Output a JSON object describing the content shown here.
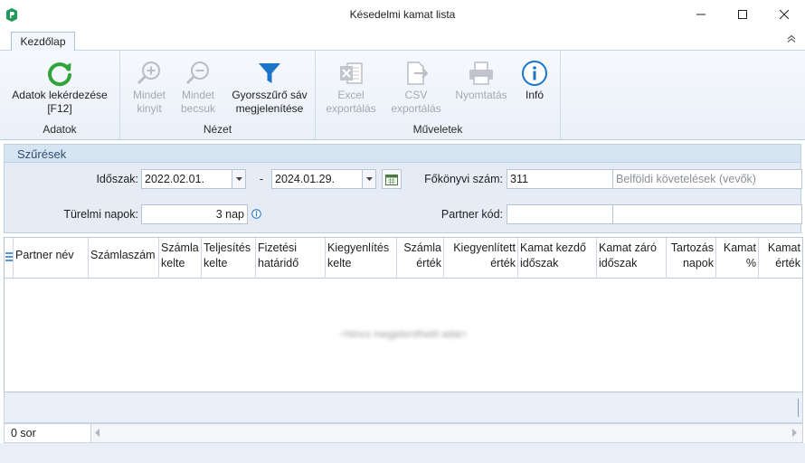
{
  "window": {
    "title": "Késedelmi kamat lista"
  },
  "ribbon": {
    "tab": "Kezdőlap",
    "groups": {
      "adatok": {
        "title": "Adatok",
        "refresh_line1": "Adatok lekérdezése",
        "refresh_line2": "[F12]"
      },
      "nezet": {
        "title": "Nézet",
        "expand_line1": "Mindet",
        "expand_line2": "kinyit",
        "collapse_line1": "Mindet",
        "collapse_line2": "becsuk",
        "filter_line1": "Gyorsszűrő sáv",
        "filter_line2": "megjelenítése"
      },
      "muveletek": {
        "title": "Műveletek",
        "excel_line1": "Excel",
        "excel_line2": "exportálás",
        "csv_line1": "CSV",
        "csv_line2": "exportálás",
        "print": "Nyomtatás",
        "info": "Infó"
      }
    }
  },
  "filters": {
    "title": "Szűrések",
    "period_label": "Időszak:",
    "date_from": "2022.02.01.",
    "dash": "-",
    "date_to": "2024.01.29.",
    "ledger_label": "Főkönyvi szám:",
    "ledger_value": "311",
    "ledger_name": "Belföldi követelések (vevők)",
    "grace_label": "Türelmi napok:",
    "grace_value": "3 nap",
    "partner_label": "Partner kód:",
    "partner_value": "",
    "partner_name": ""
  },
  "grid": {
    "columns": [
      {
        "line1": "Partner név",
        "line2": ""
      },
      {
        "line1": "Számlaszám",
        "line2": ""
      },
      {
        "line1": "Számla",
        "line2": "kelte"
      },
      {
        "line1": "Teljesítés",
        "line2": "kelte"
      },
      {
        "line1": "Fizetési",
        "line2": "határidő"
      },
      {
        "line1": "Kiegyenlítés",
        "line2": "kelte"
      },
      {
        "line1": "Számla",
        "line2": "érték"
      },
      {
        "line1": "Kiegyenlített",
        "line2": "érték"
      },
      {
        "line1": "Kamat kezdő",
        "line2": "időszak"
      },
      {
        "line1": "Kamat záró",
        "line2": "időszak"
      },
      {
        "line1": "Tartozás",
        "line2": "napok"
      },
      {
        "line1": "Kamat",
        "line2": "%"
      },
      {
        "line1": "Kamat",
        "line2": "érték"
      }
    ],
    "empty_message": "<Nincs megjeleníthető adat>"
  },
  "status": {
    "row_count": "0 sor"
  },
  "colors": {
    "accent": "#1a74c9",
    "refresh": "#2fa43a",
    "ribbon_bg": "#eef3f9"
  }
}
